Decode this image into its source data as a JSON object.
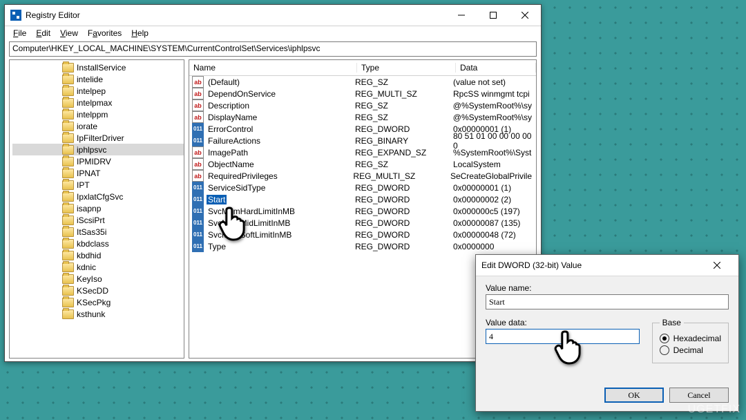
{
  "window": {
    "title": "Registry Editor",
    "menus": [
      "File",
      "Edit",
      "View",
      "Favorites",
      "Help"
    ],
    "address": "Computer\\HKEY_LOCAL_MACHINE\\SYSTEM\\CurrentControlSet\\Services\\iphlpsvc"
  },
  "tree": {
    "items": [
      {
        "label": "InstallService"
      },
      {
        "label": "intelide"
      },
      {
        "label": "intelpep"
      },
      {
        "label": "intelpmax"
      },
      {
        "label": "intelppm"
      },
      {
        "label": "iorate"
      },
      {
        "label": "IpFilterDriver"
      },
      {
        "label": "iphlpsvc",
        "selected": true
      },
      {
        "label": "IPMIDRV"
      },
      {
        "label": "IPNAT"
      },
      {
        "label": "IPT"
      },
      {
        "label": "IpxlatCfgSvc"
      },
      {
        "label": "isapnp"
      },
      {
        "label": "iScsiPrt"
      },
      {
        "label": "ItSas35i"
      },
      {
        "label": "kbdclass"
      },
      {
        "label": "kbdhid"
      },
      {
        "label": "kdnic"
      },
      {
        "label": "KeyIso"
      },
      {
        "label": "KSecDD"
      },
      {
        "label": "KSecPkg"
      },
      {
        "label": "ksthunk"
      }
    ]
  },
  "list": {
    "columns": {
      "name": "Name",
      "type": "Type",
      "data": "Data"
    },
    "rows": [
      {
        "icon": "ab",
        "name": "(Default)",
        "type": "REG_SZ",
        "data": "(value not set)"
      },
      {
        "icon": "ab",
        "name": "DependOnService",
        "type": "REG_MULTI_SZ",
        "data": "RpcSS winmgmt tcpi"
      },
      {
        "icon": "ab",
        "name": "Description",
        "type": "REG_SZ",
        "data": "@%SystemRoot%\\sy"
      },
      {
        "icon": "ab",
        "name": "DisplayName",
        "type": "REG_SZ",
        "data": "@%SystemRoot%\\sy"
      },
      {
        "icon": "bin",
        "name": "ErrorControl",
        "type": "REG_DWORD",
        "data": "0x00000001 (1)"
      },
      {
        "icon": "bin",
        "name": "FailureActions",
        "type": "REG_BINARY",
        "data": "80 51 01 00 00 00 00 0"
      },
      {
        "icon": "ab",
        "name": "ImagePath",
        "type": "REG_EXPAND_SZ",
        "data": "%SystemRoot%\\Syst"
      },
      {
        "icon": "ab",
        "name": "ObjectName",
        "type": "REG_SZ",
        "data": "LocalSystem"
      },
      {
        "icon": "ab",
        "name": "RequiredPrivileges",
        "type": "REG_MULTI_SZ",
        "data": "SeCreateGlobalPrivile"
      },
      {
        "icon": "bin",
        "name": "ServiceSidType",
        "type": "REG_DWORD",
        "data": "0x00000001 (1)"
      },
      {
        "icon": "bin",
        "name": "Start",
        "type": "REG_DWORD",
        "data": "0x00000002 (2)",
        "selected": true
      },
      {
        "icon": "bin",
        "name": "SvcMemHardLimitInMB",
        "type": "REG_DWORD",
        "data": "0x000000c5 (197)"
      },
      {
        "icon": "bin",
        "name": "SvcMemMidLimitInMB",
        "type": "REG_DWORD",
        "data": "0x00000087 (135)"
      },
      {
        "icon": "bin",
        "name": "SvcMemSoftLimitInMB",
        "type": "REG_DWORD",
        "data": "0x00000048 (72)"
      },
      {
        "icon": "bin",
        "name": "Type",
        "type": "REG_DWORD",
        "data": "0x0000000"
      }
    ]
  },
  "dialog": {
    "title": "Edit DWORD (32-bit) Value",
    "valueNameLabel": "Value name:",
    "valueName": "Start",
    "valueDataLabel": "Value data:",
    "valueData": "4",
    "baseLabel": "Base",
    "hex": "Hexadecimal",
    "dec": "Decimal",
    "ok": "OK",
    "cancel": "Cancel"
  },
  "watermark": "UGETFIX"
}
